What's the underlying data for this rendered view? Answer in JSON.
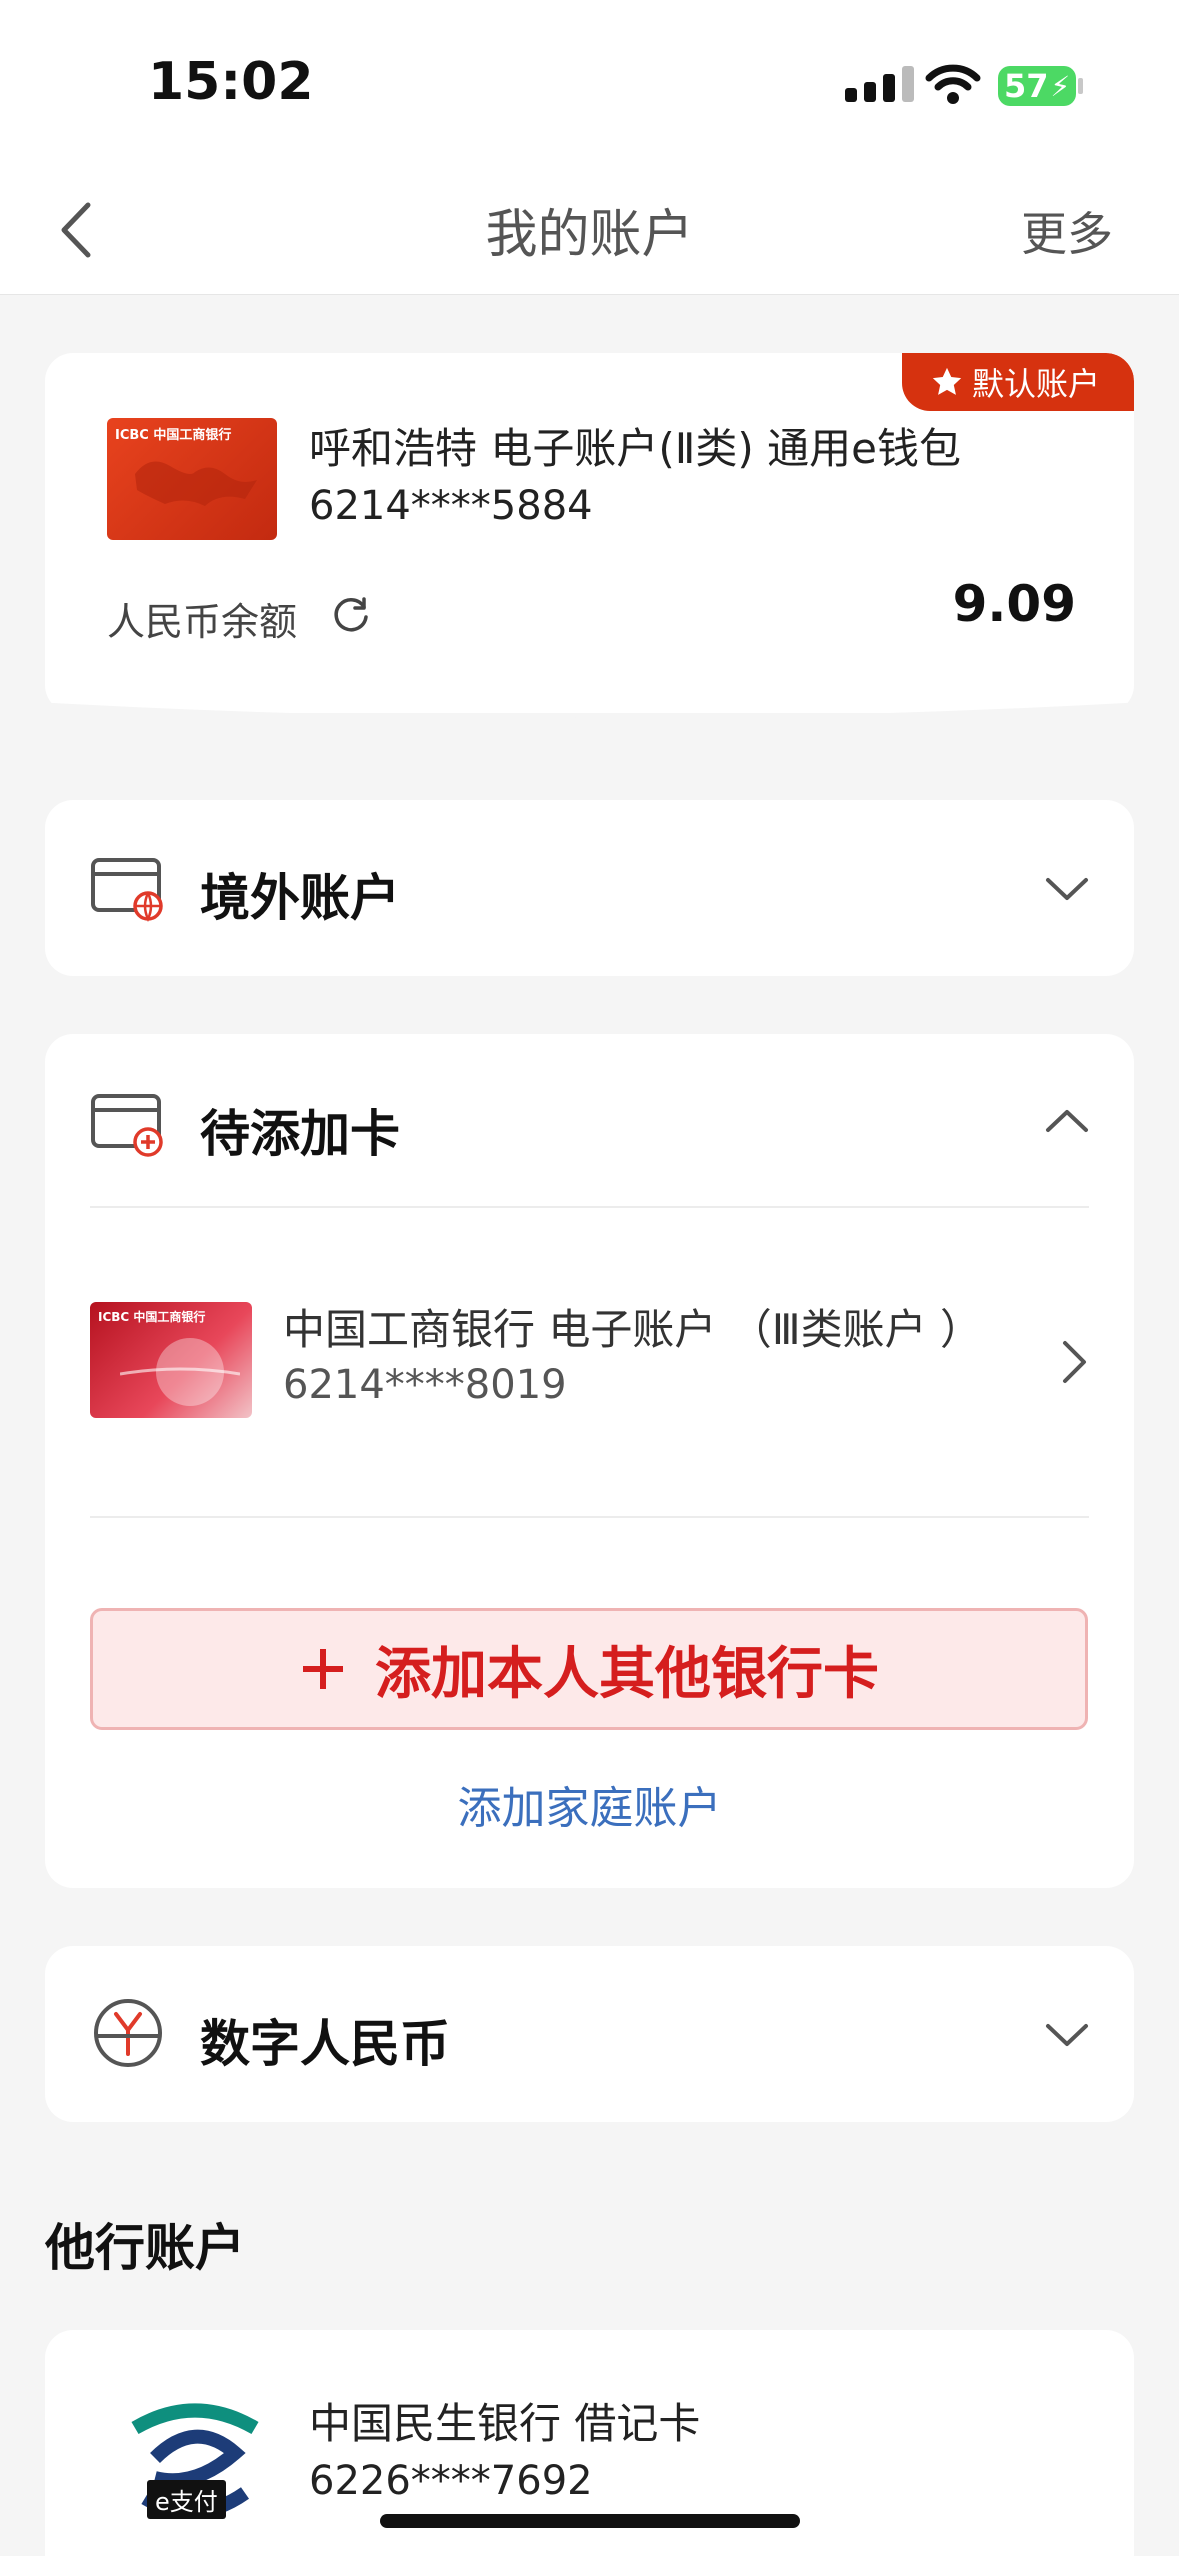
{
  "status_bar": {
    "time": "15:02",
    "battery": "57"
  },
  "nav": {
    "title": "我的账户",
    "more": "更多"
  },
  "default_account": {
    "badge": "默认账户",
    "card_brand": "ICBC 中国工商银行",
    "name": "呼和浩特 电子账户(Ⅱ类) 通用e钱包",
    "number": "6214****5884",
    "balance_label": "人民币余额",
    "balance": "9.09"
  },
  "overseas": {
    "title": "境外账户"
  },
  "pending": {
    "title": "待添加卡",
    "card": {
      "card_brand": "ICBC 中国工商银行",
      "name": "中国工商银行 电子账户 （Ⅲ类账户 ）",
      "number": "6214****8019"
    },
    "add_button": "添加本人其他银行卡",
    "add_family": "添加家庭账户"
  },
  "digital_rmb": {
    "title": "数字人民币"
  },
  "other_banks": {
    "title": "他行账户",
    "card": {
      "tag": "e支付",
      "name": "中国民生银行 借记卡",
      "number": "6226****7692"
    }
  },
  "colors": {
    "accent_red": "#d6320f",
    "link_blue": "#3b6fbd",
    "add_btn_bg": "#fde9e9"
  },
  "icons": [
    "back-arrow-icon",
    "wifi-icon",
    "star-icon",
    "refresh-icon",
    "overseas-card-icon",
    "add-card-icon",
    "yuan-icon",
    "chevron-down-icon",
    "chevron-up-icon",
    "chevron-right-icon",
    "plus-icon"
  ]
}
